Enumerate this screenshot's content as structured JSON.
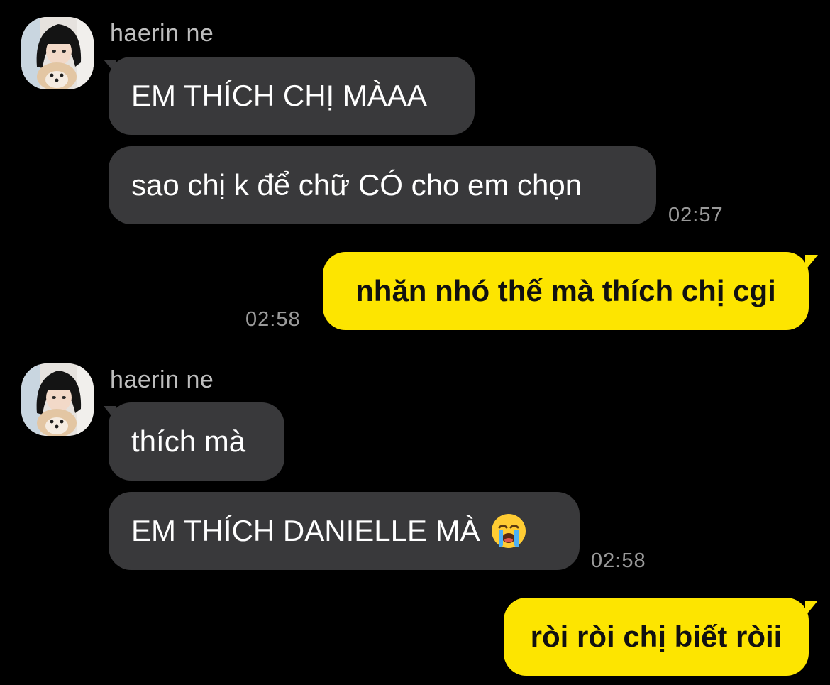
{
  "colors": {
    "background": "#000000",
    "incoming_bubble": "#39393b",
    "outgoing_bubble": "#fde500",
    "timestamp": "#9a9a9a",
    "sender_name": "#bdbdbd"
  },
  "groups": [
    {
      "sender": "haerin ne",
      "avatar_icon": "profile-photo-girl-with-dog",
      "messages": [
        "EM THÍCH CHỊ MÀAA",
        "sao chị k để chữ CÓ cho em chọn"
      ],
      "time": "02:57"
    },
    {
      "outgoing": "nhăn nhó thế mà thích chị cgi",
      "time": "02:58"
    },
    {
      "sender": "haerin ne",
      "avatar_icon": "profile-photo-girl-with-dog",
      "messages": [
        "thích mà",
        "EM THÍCH DANIELLE MÀ"
      ],
      "emoji": "loudly-crying-face-icon",
      "time": "02:58"
    },
    {
      "outgoing": "ròi ròi chị biết ròii"
    }
  ]
}
